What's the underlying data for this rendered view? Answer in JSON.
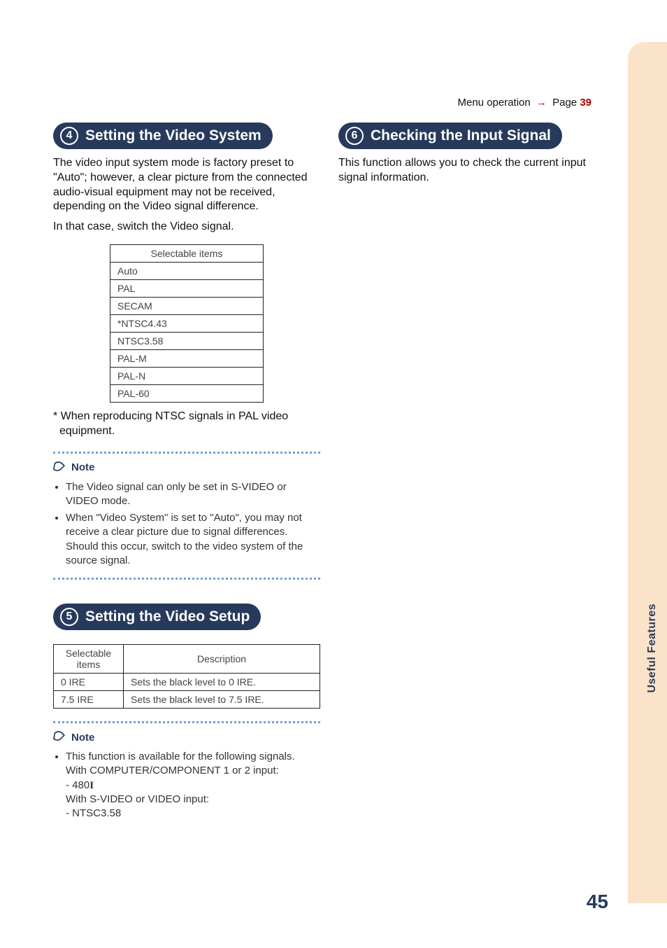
{
  "header": {
    "menu_text": "Menu operation",
    "page_link": "Page",
    "page_num": "39"
  },
  "side_tab": {
    "label": "Useful\nFeatures"
  },
  "page_number": "45",
  "sec4": {
    "num": "4",
    "title": "Setting the Video System",
    "para1": "The video input system mode is factory preset to \"Auto\"; however, a clear picture from the connected audio-visual equipment may not be received, depending on the Video signal difference.",
    "para2": "In that case, switch the Video signal.",
    "table_header": "Selectable items",
    "items": [
      "Auto",
      "PAL",
      "SECAM",
      "*NTSC4.43",
      "NTSC3.58",
      "PAL-M",
      "PAL-N",
      "PAL-60"
    ],
    "footnote": "* When reproducing NTSC signals in PAL video equipment.",
    "note_label": "Note",
    "notes": [
      "The Video signal can only be set in S-VIDEO or VIDEO mode.",
      "When \"Video System\" is set to \"Auto\", you may not receive a clear picture due to signal differences. Should this occur, switch to the video system of the source signal."
    ]
  },
  "sec5": {
    "num": "5",
    "title": "Setting the Video Setup",
    "col1": "Selectable items",
    "col2": "Description",
    "rows": [
      {
        "item": "0 IRE",
        "desc": "Sets the black level to 0 IRE."
      },
      {
        "item": "7.5 IRE",
        "desc": "Sets the black level to 7.5 IRE."
      }
    ],
    "note_label": "Note",
    "note_intro": "This function is available for the following signals.",
    "note_l1": "With COMPUTER/COMPONENT 1 or 2 input:",
    "note_l2a": "- 480",
    "note_l2b": "I",
    "note_l3": "With S-VIDEO or VIDEO input:",
    "note_l4": "- NTSC3.58"
  },
  "sec6": {
    "num": "6",
    "title": "Checking the Input Signal",
    "para": "This function allows you to check the current input signal information."
  }
}
